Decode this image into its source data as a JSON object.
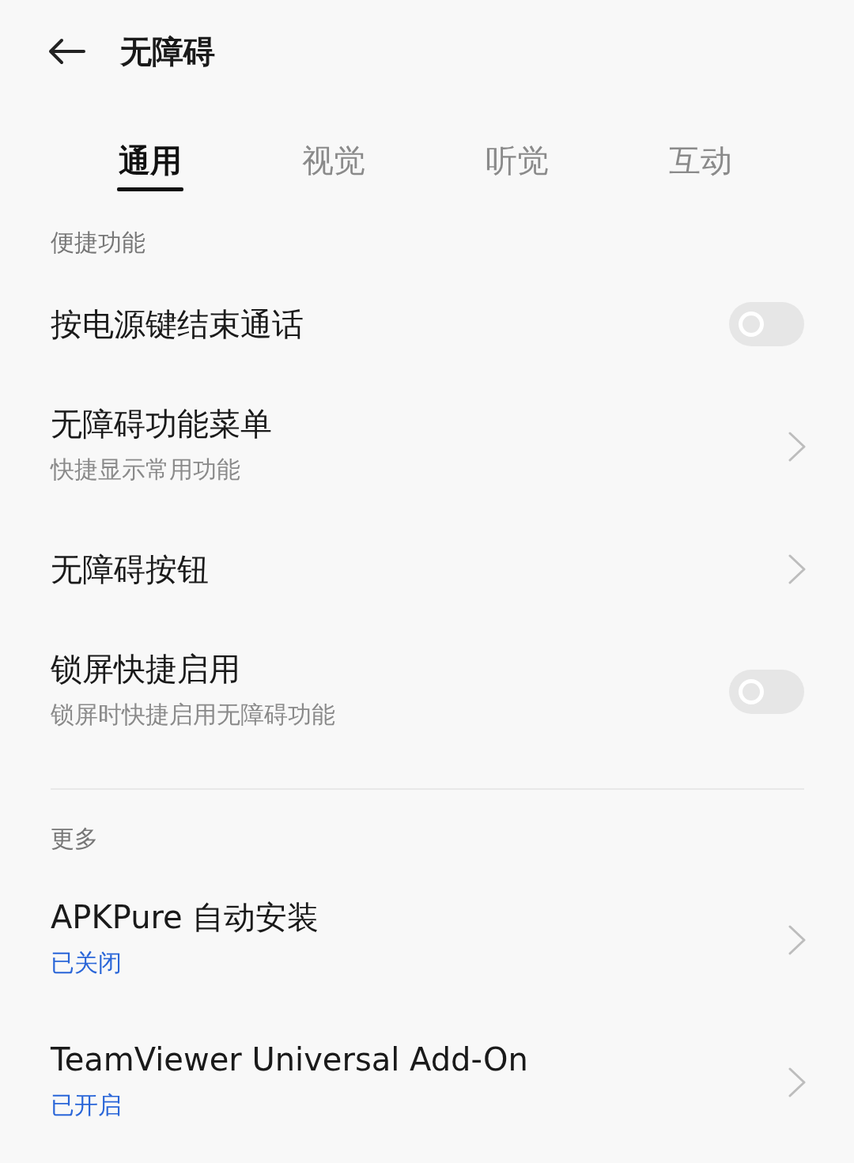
{
  "header": {
    "title": "无障碍"
  },
  "tabs": [
    {
      "label": "通用",
      "selected": true
    },
    {
      "label": "视觉",
      "selected": false
    },
    {
      "label": "听觉",
      "selected": false
    },
    {
      "label": "互动",
      "selected": false
    }
  ],
  "sections": [
    {
      "title": "便捷功能",
      "items": [
        {
          "kind": "toggle",
          "title": "按电源键结束通话",
          "on": false
        },
        {
          "kind": "link",
          "title": "无障碍功能菜单",
          "subtitle": "快捷显示常用功能",
          "status": false
        },
        {
          "kind": "link",
          "title": "无障碍按钮"
        },
        {
          "kind": "toggle",
          "title": "锁屏快捷启用",
          "subtitle": "锁屏时快捷启用无障碍功能",
          "status": false,
          "on": false
        }
      ]
    },
    {
      "title": "更多",
      "items": [
        {
          "kind": "link",
          "title": "APKPure 自动安装",
          "subtitle": "已关闭",
          "status": true
        },
        {
          "kind": "link",
          "title": "TeamViewer Universal Add-On",
          "subtitle": "已开启",
          "status": true
        }
      ]
    }
  ]
}
